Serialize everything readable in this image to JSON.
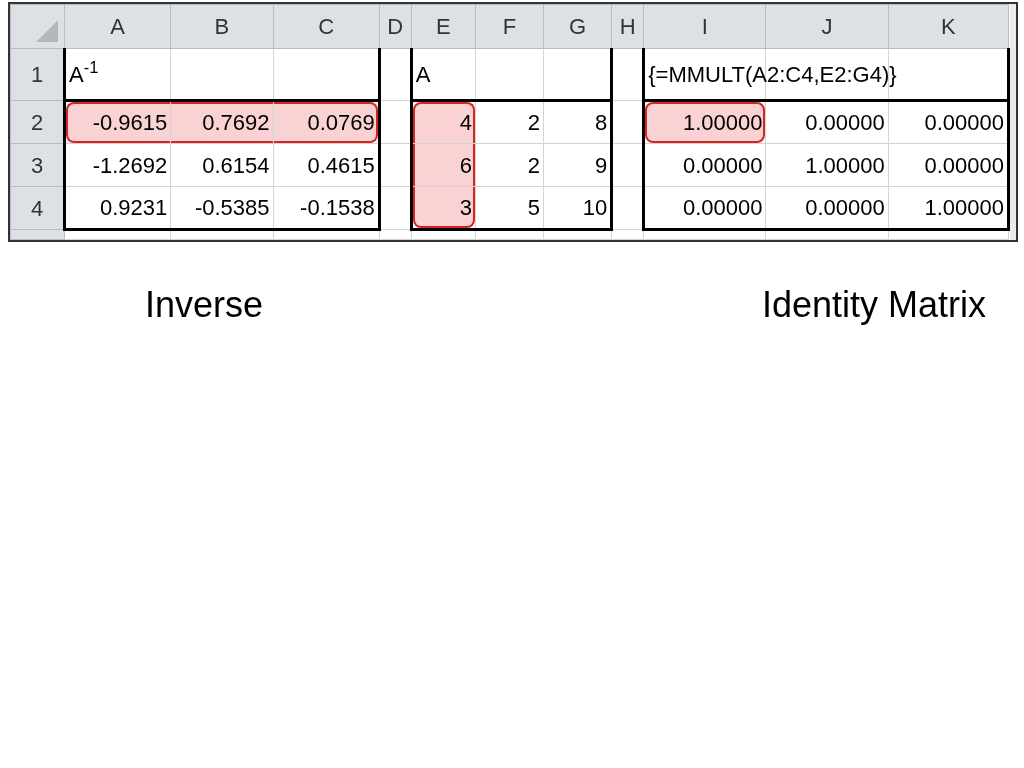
{
  "spreadsheet": {
    "columns": [
      "A",
      "B",
      "C",
      "D",
      "E",
      "F",
      "G",
      "H",
      "I",
      "J",
      "K"
    ],
    "rows": [
      {
        "header": "1",
        "cells": [
          {
            "text": "A$^{-1}$",
            "highlighted": false
          },
          null,
          null,
          null,
          {
            "text": "A",
            "highlighted": false
          },
          null,
          null,
          null,
          {
            "text": "{=MMULT(A2:C4,E2:G4)}",
            "highlighted": false
          },
          null,
          null
        ]
      },
      {
        "header": "2",
        "cells": [
          {
            "text": "-0.9615",
            "highlighted": true
          },
          {
            "text": "0.7692",
            "highlighted": true
          },
          {
            "text": "0.0769",
            "highlighted": true
          },
          null,
          {
            "text": "4",
            "highlighted": true
          },
          {
            "text": "2",
            "highlighted": false
          },
          {
            "text": "8",
            "highlighted": false
          },
          null,
          {
            "text": "1.00000",
            "highlighted": true
          },
          {
            "text": "0.00000",
            "highlighted": false
          },
          {
            "text": "0.00000",
            "highlighted": false
          }
        ]
      },
      {
        "header": "3",
        "cells": [
          {
            "text": "-1.2692",
            "highlighted": false
          },
          {
            "text": "0.6154",
            "highlighted": false
          },
          {
            "text": "0.4615",
            "highlighted": false
          },
          null,
          {
            "text": "6",
            "highlighted": true
          },
          {
            "text": "2",
            "highlighted": false
          },
          {
            "text": "9",
            "highlighted": false
          },
          null,
          {
            "text": "0.00000",
            "highlighted": false
          },
          {
            "text": "1.00000",
            "highlighted": false
          },
          {
            "text": "0.00000",
            "highlighted": false
          }
        ]
      },
      {
        "header": "4",
        "cells": [
          {
            "text": "0.9231",
            "highlighted": false
          },
          {
            "text": "-0.5385",
            "highlighted": false
          },
          {
            "text": "-0.1538",
            "highlighted": false
          },
          null,
          {
            "text": "3",
            "highlighted": true
          },
          {
            "text": "5",
            "highlighted": false
          },
          {
            "text": "10",
            "highlighted": false
          },
          null,
          {
            "text": "0.00000",
            "highlighted": false
          },
          {
            "text": "0.00000",
            "highlighted": false
          },
          {
            "text": "1.00000",
            "highlighted": false
          }
        ]
      }
    ]
  },
  "captions": [
    "Inverse",
    "Identity Matrix"
  ]
}
